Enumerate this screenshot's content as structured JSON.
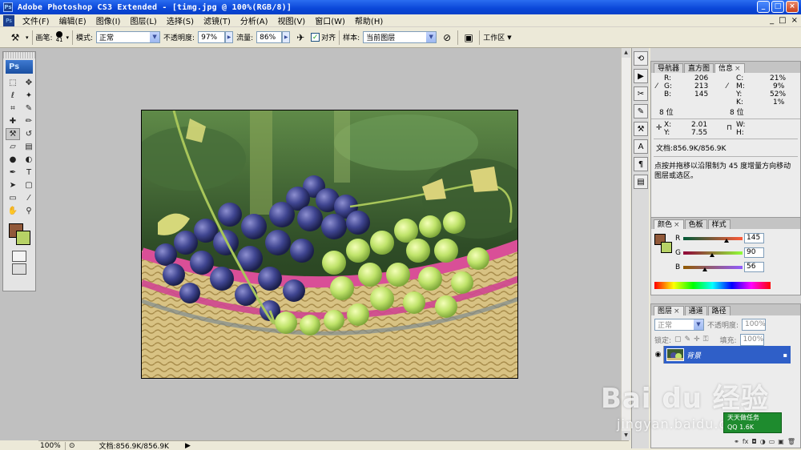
{
  "window": {
    "title": "Adobe Photoshop CS3 Extended - [timg.jpg @ 100%(RGB/8)]",
    "logo": "Ps",
    "buttons": [
      "_",
      "□",
      "×"
    ]
  },
  "menubar": {
    "items": [
      "文件(F)",
      "编辑(E)",
      "图像(I)",
      "图层(L)",
      "选择(S)",
      "滤镜(T)",
      "分析(A)",
      "视图(V)",
      "窗口(W)",
      "帮助(H)"
    ],
    "doc_buttons": [
      "_",
      "□",
      "×"
    ]
  },
  "options": {
    "brush_label": "画笔:",
    "brush_size": "41",
    "mode_label": "模式:",
    "mode_value": "正常",
    "opacity_label": "不透明度:",
    "opacity_value": "97%",
    "flow_label": "流量:",
    "flow_value": "86%",
    "align_label": "对齐",
    "sample_label": "样本:",
    "sample_value": "当前图层",
    "workspace_label": "工作区"
  },
  "toolbox": {
    "logo": "Ps",
    "foreground_color": "#91593a",
    "background_color": "#b7d266",
    "tools": [
      "marquee-icon",
      "move-icon",
      "lasso-icon",
      "magic-wand-icon",
      "crop-icon",
      "slice-icon",
      "healing-icon",
      "brush-icon",
      "clone-stamp-icon",
      "history-brush-icon",
      "eraser-icon",
      "gradient-icon",
      "blur-icon",
      "dodge-icon",
      "pen-icon",
      "type-icon",
      "path-select-icon",
      "shape-icon",
      "notes-icon",
      "eyedropper-icon",
      "hand-icon",
      "zoom-icon"
    ]
  },
  "status": {
    "zoom": "100%",
    "doc_info": "文档:856.9K/856.9K"
  },
  "info_panel": {
    "tabs": [
      "导航器",
      "直方图",
      "信息"
    ],
    "R": "206",
    "G": "213",
    "B": "145",
    "C": "21%",
    "M": "9%",
    "Y": "52%",
    "K": "1%",
    "bit_left": "8 位",
    "bit_right": "8 位",
    "X": "2.01",
    "Y_coord": "7.55",
    "W": "",
    "H": "",
    "doc": "文档:856.9K/856.9K",
    "hint": "点按并拖移以沿限制为 45 度增量方向移动图层或选区。"
  },
  "color_panel": {
    "tabs": [
      "颜色",
      "色板",
      "样式"
    ],
    "R": "145",
    "G": "90",
    "B": "56",
    "swatch_fg": "#91593a",
    "swatch_bg": "#b7d266"
  },
  "layers_panel": {
    "tabs": [
      "图层",
      "通道",
      "路径"
    ],
    "blend_mode": "正常",
    "opacity_label": "不透明度:",
    "opacity_value": "100%",
    "lock_label": "锁定:",
    "fill_label": "填充:",
    "fill_value": "100%",
    "layer_name": "背景"
  },
  "watermark": {
    "logo": "Bai du 经验",
    "url": "jingyan.baidu.com",
    "badge_line1": "天天做任务",
    "badge_line2": "QQ 1.6K"
  }
}
